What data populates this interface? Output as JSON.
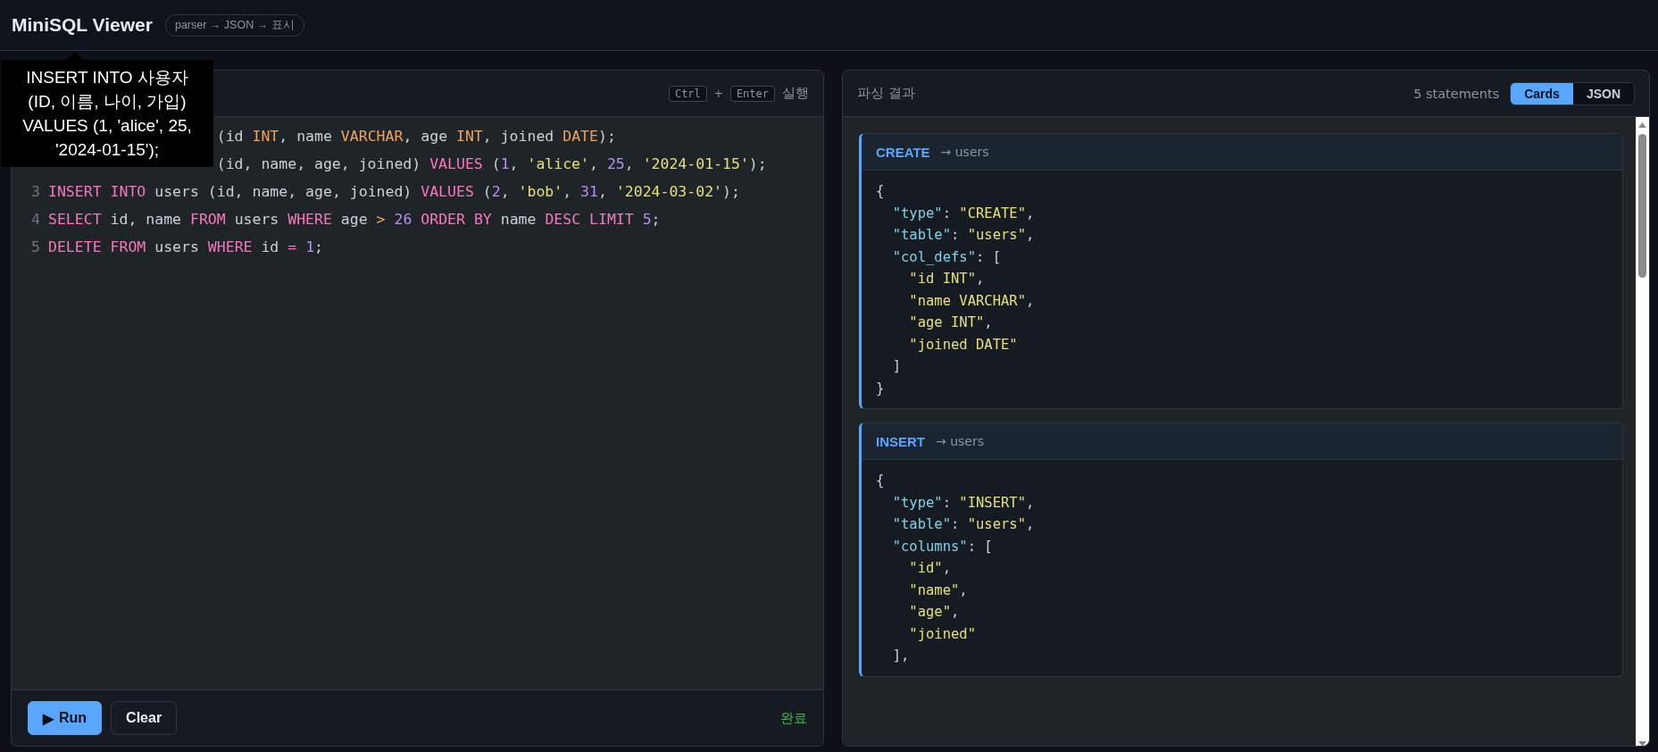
{
  "header": {
    "title": "MiniSQL Viewer",
    "badge": "parser → JSON → 표시"
  },
  "tooltip": {
    "text": "INSERT INTO 사용자 (ID, 이름, 나이, 가입) VALUES (1, 'alice', 25, '2024-01-15');"
  },
  "editor": {
    "shortcut": {
      "keys": [
        "Ctrl",
        "Enter"
      ],
      "joiner": "+",
      "label": "실행"
    },
    "lines": [
      {
        "covered": true,
        "tokens": [
          {
            "kind": "plain",
            "text": "(id "
          },
          {
            "kind": "type",
            "text": "INT"
          },
          {
            "kind": "plain",
            "text": ", name "
          },
          {
            "kind": "type",
            "text": "VARCHAR"
          },
          {
            "kind": "plain",
            "text": ", age "
          },
          {
            "kind": "type",
            "text": "INT"
          },
          {
            "kind": "plain",
            "text": ", joined "
          },
          {
            "kind": "type",
            "text": "DATE"
          },
          {
            "kind": "plain",
            "text": ");"
          }
        ]
      },
      {
        "covered": true,
        "tokens": [
          {
            "kind": "plain",
            "text": "(id, name, age, joined) "
          },
          {
            "kind": "keyword",
            "text": "VALUES"
          },
          {
            "kind": "plain",
            "text": " ("
          },
          {
            "kind": "number",
            "text": "1"
          },
          {
            "kind": "plain",
            "text": ", "
          },
          {
            "kind": "string",
            "text": "'alice'"
          },
          {
            "kind": "plain",
            "text": ", "
          },
          {
            "kind": "number",
            "text": "25"
          },
          {
            "kind": "plain",
            "text": ", "
          },
          {
            "kind": "string",
            "text": "'2024-01-15'"
          },
          {
            "kind": "plain",
            "text": ");"
          }
        ]
      },
      {
        "covered": false,
        "number": "3",
        "tokens": [
          {
            "kind": "keyword",
            "text": "INSERT INTO"
          },
          {
            "kind": "plain",
            "text": " users (id, name, age, joined) "
          },
          {
            "kind": "keyword",
            "text": "VALUES"
          },
          {
            "kind": "plain",
            "text": " ("
          },
          {
            "kind": "number",
            "text": "2"
          },
          {
            "kind": "plain",
            "text": ", "
          },
          {
            "kind": "string",
            "text": "'bob'"
          },
          {
            "kind": "plain",
            "text": ", "
          },
          {
            "kind": "number",
            "text": "31"
          },
          {
            "kind": "plain",
            "text": ", "
          },
          {
            "kind": "string",
            "text": "'2024-03-02'"
          },
          {
            "kind": "plain",
            "text": ");"
          }
        ]
      },
      {
        "covered": false,
        "number": "4",
        "tokens": [
          {
            "kind": "keyword",
            "text": "SELECT"
          },
          {
            "kind": "plain",
            "text": " id, name "
          },
          {
            "kind": "keyword",
            "text": "FROM"
          },
          {
            "kind": "plain",
            "text": " users "
          },
          {
            "kind": "keyword",
            "text": "WHERE"
          },
          {
            "kind": "plain",
            "text": " age "
          },
          {
            "kind": "operator",
            "text": "> "
          },
          {
            "kind": "number",
            "text": "26 "
          },
          {
            "kind": "keyword",
            "text": "ORDER BY"
          },
          {
            "kind": "plain",
            "text": " name "
          },
          {
            "kind": "keyword",
            "text": "DESC LIMIT "
          },
          {
            "kind": "number",
            "text": "5"
          },
          {
            "kind": "plain",
            "text": ";"
          }
        ]
      },
      {
        "covered": false,
        "number": "5",
        "tokens": [
          {
            "kind": "keyword",
            "text": "DELETE FROM"
          },
          {
            "kind": "plain",
            "text": " users "
          },
          {
            "kind": "keyword",
            "text": "WHERE"
          },
          {
            "kind": "plain",
            "text": " id "
          },
          {
            "kind": "keyword",
            "text": "= "
          },
          {
            "kind": "number",
            "text": "1"
          },
          {
            "kind": "plain",
            "text": ";"
          }
        ]
      }
    ],
    "buttons": [
      {
        "kind": "primary",
        "icon": "▶",
        "label": "Run"
      },
      {
        "kind": "secondary",
        "label": "Clear"
      }
    ],
    "status": "완료"
  },
  "results": {
    "title": "파싱 결과",
    "count": "5 statements",
    "views": [
      {
        "label": "Cards",
        "selected": true
      },
      {
        "label": "JSON",
        "selected": false
      }
    ],
    "cards": [
      {
        "type": "CREATE",
        "target": "→ users",
        "lines": [
          [
            {
              "kind": "plain",
              "text": "{"
            }
          ],
          [
            {
              "kind": "key",
              "text": "  \"type\""
            },
            {
              "kind": "plain",
              "text": ": "
            },
            {
              "kind": "string",
              "text": "\"CREATE\""
            },
            {
              "kind": "plain",
              "text": ","
            }
          ],
          [
            {
              "kind": "key",
              "text": "  \"table\""
            },
            {
              "kind": "plain",
              "text": ": "
            },
            {
              "kind": "string",
              "text": "\"users\""
            },
            {
              "kind": "plain",
              "text": ","
            }
          ],
          [
            {
              "kind": "key",
              "text": "  \"col_defs\""
            },
            {
              "kind": "plain",
              "text": ": ["
            }
          ],
          [
            {
              "kind": "string",
              "text": "    \"id INT\""
            },
            {
              "kind": "plain",
              "text": ","
            }
          ],
          [
            {
              "kind": "string",
              "text": "    \"name VARCHAR\""
            },
            {
              "kind": "plain",
              "text": ","
            }
          ],
          [
            {
              "kind": "string",
              "text": "    \"age INT\""
            },
            {
              "kind": "plain",
              "text": ","
            }
          ],
          [
            {
              "kind": "string",
              "text": "    \"joined DATE\""
            }
          ],
          [
            {
              "kind": "plain",
              "text": "  ]"
            }
          ],
          [
            {
              "kind": "plain",
              "text": "}"
            }
          ]
        ]
      },
      {
        "type": "INSERT",
        "target": "→ users",
        "lines": [
          [
            {
              "kind": "plain",
              "text": "{"
            }
          ],
          [
            {
              "kind": "key",
              "text": "  \"type\""
            },
            {
              "kind": "plain",
              "text": ": "
            },
            {
              "kind": "string",
              "text": "\"INSERT\""
            },
            {
              "kind": "plain",
              "text": ","
            }
          ],
          [
            {
              "kind": "key",
              "text": "  \"table\""
            },
            {
              "kind": "plain",
              "text": ": "
            },
            {
              "kind": "string",
              "text": "\"users\""
            },
            {
              "kind": "plain",
              "text": ","
            }
          ],
          [
            {
              "kind": "key",
              "text": "  \"columns\""
            },
            {
              "kind": "plain",
              "text": ": ["
            }
          ],
          [
            {
              "kind": "string",
              "text": "    \"id\""
            },
            {
              "kind": "plain",
              "text": ","
            }
          ],
          [
            {
              "kind": "string",
              "text": "    \"name\""
            },
            {
              "kind": "plain",
              "text": ","
            }
          ],
          [
            {
              "kind": "string",
              "text": "    \"age\""
            },
            {
              "kind": "plain",
              "text": ","
            }
          ],
          [
            {
              "kind": "string",
              "text": "    \"joined\""
            }
          ],
          [
            {
              "kind": "plain",
              "text": "  ],"
            }
          ]
        ]
      }
    ]
  }
}
